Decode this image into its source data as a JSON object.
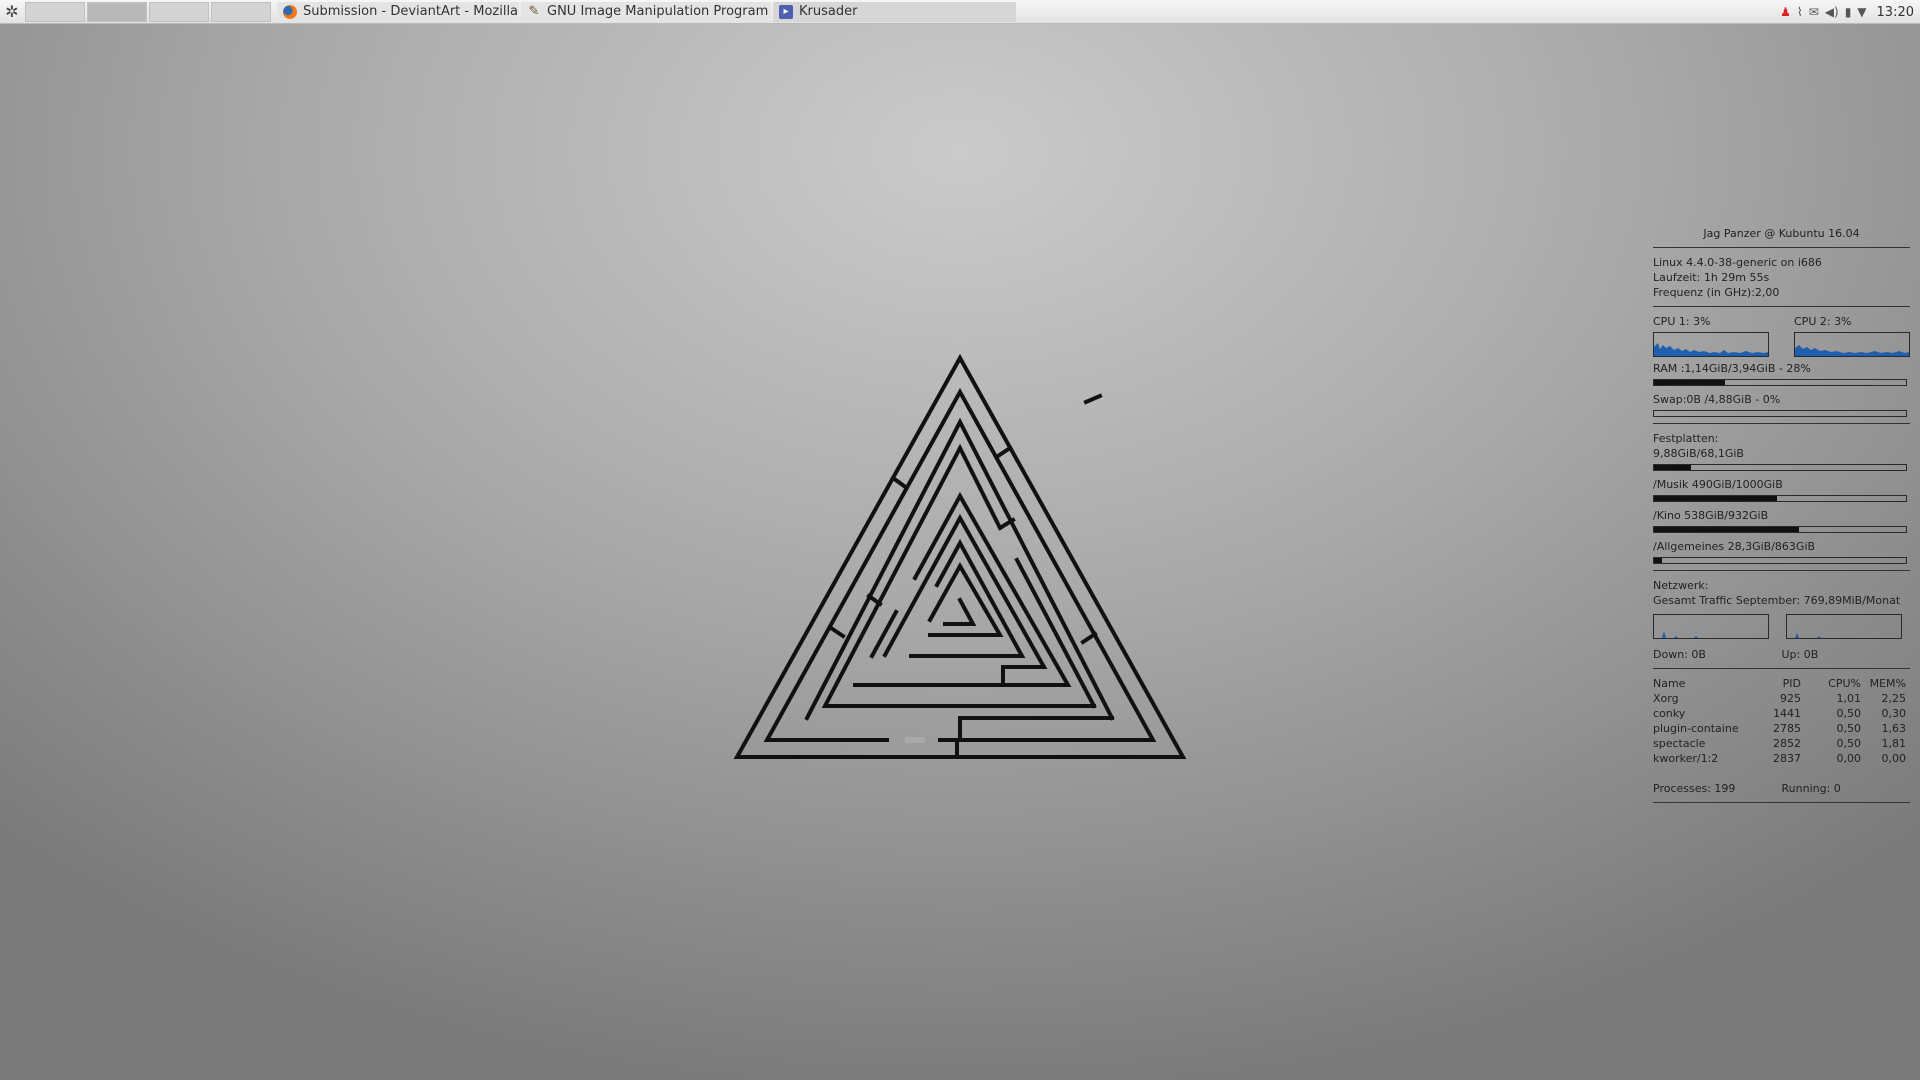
{
  "taskbar": {
    "launcher_icon": "kde-menu-icon",
    "desktops": 4,
    "active_desktop": 2,
    "tasks": [
      {
        "label": "Submission - DeviantArt - Mozilla Fi",
        "icon": "firefox-icon"
      },
      {
        "label": "GNU Image Manipulation Program",
        "icon": "gimp-icon"
      },
      {
        "label": "Krusader",
        "icon": "krusader-icon"
      }
    ],
    "tray_icons": [
      "updates-icon",
      "paperclip-icon",
      "mail-icon",
      "volume-icon",
      "network-icon",
      "expand-arrow-icon"
    ],
    "clock": "13:20"
  },
  "conky": {
    "header": "Jag Panzer @ Kubuntu 16.04",
    "system": {
      "kernel": "Linux 4.4.0-38-generic on i686",
      "uptime": "Laufzeit: 1h 29m 55s",
      "frequency": "Frequenz (in GHz):2,00"
    },
    "cpu": [
      {
        "label": "CPU 1:  3%",
        "usage_pct": 3
      },
      {
        "label": "CPU 2:  3%",
        "usage_pct": 3
      }
    ],
    "ram": {
      "label": "RAM :1,14GiB/3,94GiB - 28%",
      "pct": 28
    },
    "swap": {
      "label": "Swap:0B  /4,88GiB - 0%",
      "pct": 0
    },
    "disks_title": "Festplatten:",
    "disks": [
      {
        "label": "9,88GiB/68,1GiB",
        "pct": 14.5
      },
      {
        "label": "/Musik 490GiB/1000GiB",
        "pct": 49
      },
      {
        "label": "/Kino  538GiB/932GiB",
        "pct": 57.7
      },
      {
        "label": "/Allgemeines   28,3GiB/863GiB",
        "pct": 3.3
      }
    ],
    "network": {
      "title": "Netzwerk:",
      "traffic": "Gesamt Traffic September: 769,89MiB/Monat",
      "down": "Down: 0B",
      "up": "Up: 0B"
    },
    "processes": {
      "headers": [
        "Name",
        "PID",
        "CPU%",
        "MEM%"
      ],
      "rows": [
        [
          "Xorg",
          "925",
          "1,01",
          "2,25"
        ],
        [
          "conky",
          "1441",
          "0,50",
          "0,30"
        ],
        [
          "plugin-containe",
          "2785",
          "0,50",
          "1,63"
        ],
        [
          "spectacle",
          "2852",
          "0,50",
          "1,81"
        ],
        [
          "kworker/1:2",
          "2837",
          "0,00",
          "0,00"
        ]
      ],
      "total": "Processes: 199",
      "running": "Running: 0"
    }
  },
  "colors": {
    "graph_blue": "#1f5fae",
    "bar_fill": "#111111"
  }
}
